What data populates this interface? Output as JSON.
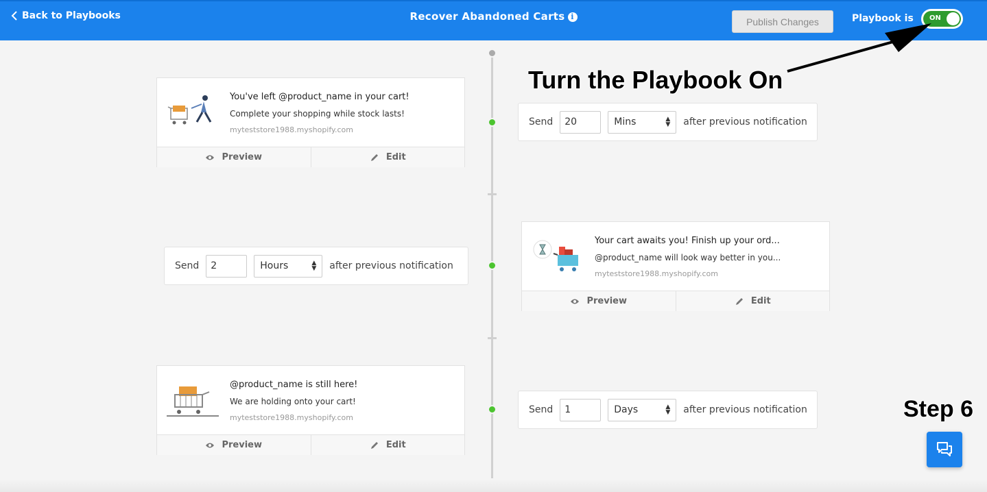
{
  "header": {
    "back_label": "Back to Playbooks",
    "title": "Recover Abandoned Carts",
    "publish_label": "Publish Changes",
    "playbook_label": "Playbook is",
    "toggle_label": "ON"
  },
  "notifications": [
    {
      "title": "You've left @product_name in your cart!",
      "message": "Complete your shopping while stock lasts!",
      "site": "myteststore1988.myshopify.com",
      "preview_label": "Preview",
      "edit_label": "Edit"
    },
    {
      "title": "Your cart awaits you! Finish up your ord...",
      "message": "@product_name will look way better in you...",
      "site": "myteststore1988.myshopify.com",
      "preview_label": "Preview",
      "edit_label": "Edit"
    },
    {
      "title": "@product_name is still here!",
      "message": "We are holding onto your cart!",
      "site": "myteststore1988.myshopify.com",
      "preview_label": "Preview",
      "edit_label": "Edit"
    }
  ],
  "delays": [
    {
      "send_label": "Send",
      "value": "20",
      "unit": "Mins",
      "suffix": "after previous notification"
    },
    {
      "send_label": "Send",
      "value": "2",
      "unit": "Hours",
      "suffix": "after previous notification"
    },
    {
      "send_label": "Send",
      "value": "1",
      "unit": "Days",
      "suffix": "after previous notification"
    }
  ],
  "annotations": {
    "turn_on": "Turn the Playbook On",
    "step": "Step 6"
  },
  "colors": {
    "header_blue": "#1b82ec",
    "toggle_green": "#2e9b2e",
    "timeline_dot_green": "#4cc430"
  }
}
